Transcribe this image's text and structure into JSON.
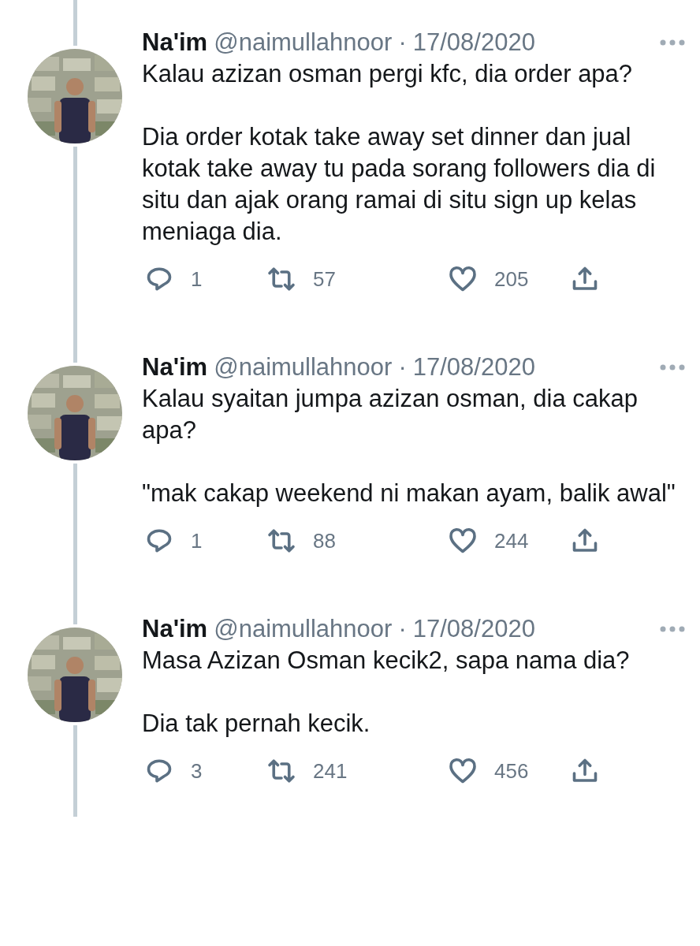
{
  "tweets": [
    {
      "name": "Na'im",
      "handle": "@naimullahnoor",
      "separator": "·",
      "date": "17/08/2020",
      "paragraphs": [
        "Kalau azizan osman pergi kfc, dia order apa?",
        "Dia order kotak take away set dinner dan jual kotak take away tu pada sorang followers dia di situ dan ajak orang ramai di situ sign up kelas meniaga dia."
      ],
      "replies": "1",
      "retweets": "57",
      "likes": "205"
    },
    {
      "name": "Na'im",
      "handle": "@naimullahnoor",
      "separator": "·",
      "date": "17/08/2020",
      "paragraphs": [
        "Kalau syaitan jumpa azizan osman, dia cakap apa?",
        "\"mak cakap weekend ni makan ayam, balik awal\""
      ],
      "replies": "1",
      "retweets": "88",
      "likes": "244"
    },
    {
      "name": "Na'im",
      "handle": "@naimullahnoor",
      "separator": "·",
      "date": "17/08/2020",
      "paragraphs": [
        "Masa Azizan Osman kecik2, sapa nama dia?",
        "Dia tak pernah kecik."
      ],
      "replies": "3",
      "retweets": "241",
      "likes": "456"
    }
  ]
}
